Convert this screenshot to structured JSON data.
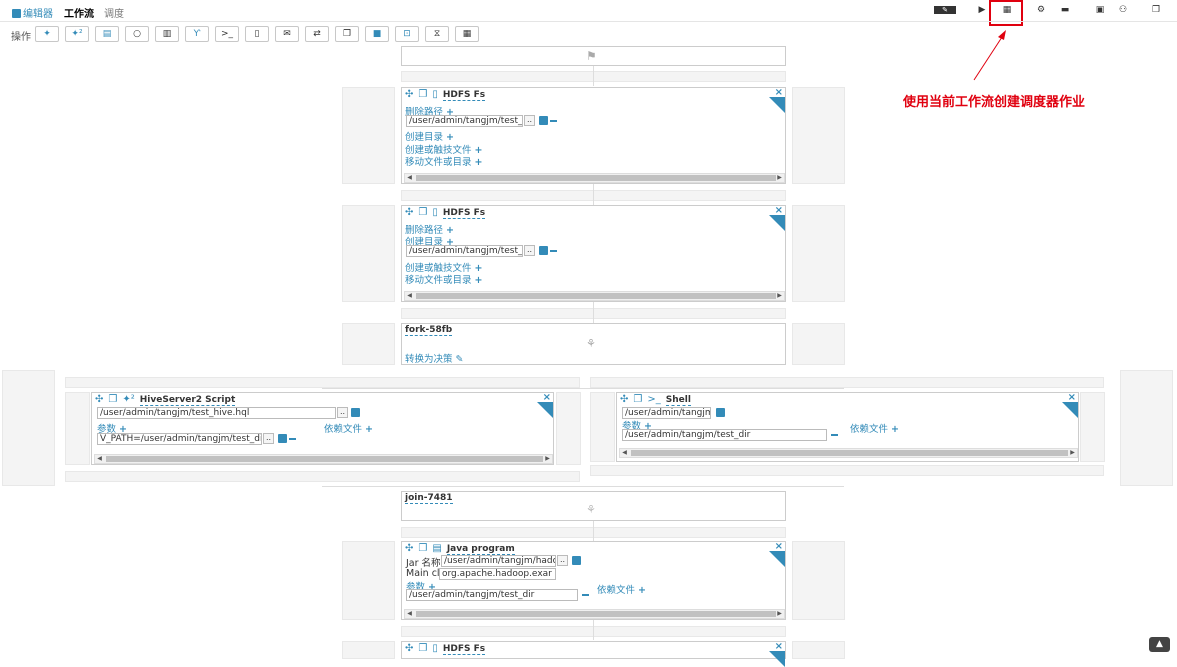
{
  "header": {
    "tabs": [
      {
        "label": "编辑器",
        "icon": "editor-icon",
        "active": false
      },
      {
        "label": "工作流",
        "active": true
      },
      {
        "label": "调度",
        "active": false
      }
    ],
    "actions": [
      "pencil-icon",
      "play-icon",
      "calendar-icon",
      "gear-icon",
      "folder-icon",
      "save-icon",
      "users-icon",
      "copy-icon"
    ]
  },
  "toolbar": {
    "label": "操作",
    "buttons": [
      "hive-icon",
      "hive2-icon",
      "pig-icon",
      "spark-icon",
      "sqoop-icon",
      "fork-icon",
      "shell-icon",
      "fs-icon",
      "email-icon",
      "distcp-icon",
      "copy-icon",
      "stop-icon",
      "java-icon",
      "timer-icon",
      "subworkflow-icon"
    ]
  },
  "annotation": {
    "text": "使用当前工作流创建调度器作业",
    "color": "#e0000f"
  },
  "nodes": {
    "hdfs1": {
      "title": "HDFS Fs",
      "delete_label": "删除路径",
      "delete_path": "/user/admin/tangjm/test_d",
      "mkdir_label": "创建目录",
      "touch_label": "创建或触技文件",
      "move_label": "移动文件或目录"
    },
    "hdfs2": {
      "title": "HDFS Fs",
      "delete_label": "删除路径",
      "mkdir_label": "创建目录",
      "mkdir_path": "/user/admin/tangjm/test_d",
      "touch_label": "创建或触技文件",
      "move_label": "移动文件或目录"
    },
    "fork": {
      "title": "fork-58fb",
      "convert_label": "转换为决策"
    },
    "hive": {
      "title": "HiveServer2 Script",
      "script_path": "/user/admin/tangjm/test_hive.hql",
      "params_label": "参数",
      "param_value": "V_PATH=/user/admin/tangjm/test_di",
      "files_label": "依赖文件"
    },
    "shell": {
      "title": "Shell",
      "command": "/user/admin/tangjm",
      "params_label": "参数",
      "param_value": "/user/admin/tangjm/test_dir",
      "files_label": "依赖文件"
    },
    "join": {
      "title": "join-7481"
    },
    "java": {
      "title": "Java program",
      "jar_label": "Jar 名称",
      "jar_path": "/user/admin/tangjm/hado",
      "main_label": "Main cl",
      "main_value": "org.apache.hadoop.exar",
      "params_label": "参数",
      "param_value": "/user/admin/tangjm/test_dir",
      "files_label": "依赖文件"
    },
    "hdfs3": {
      "title": "HDFS Fs"
    }
  },
  "colors": {
    "accent": "#338bb8",
    "highlight": "#e0000f"
  }
}
